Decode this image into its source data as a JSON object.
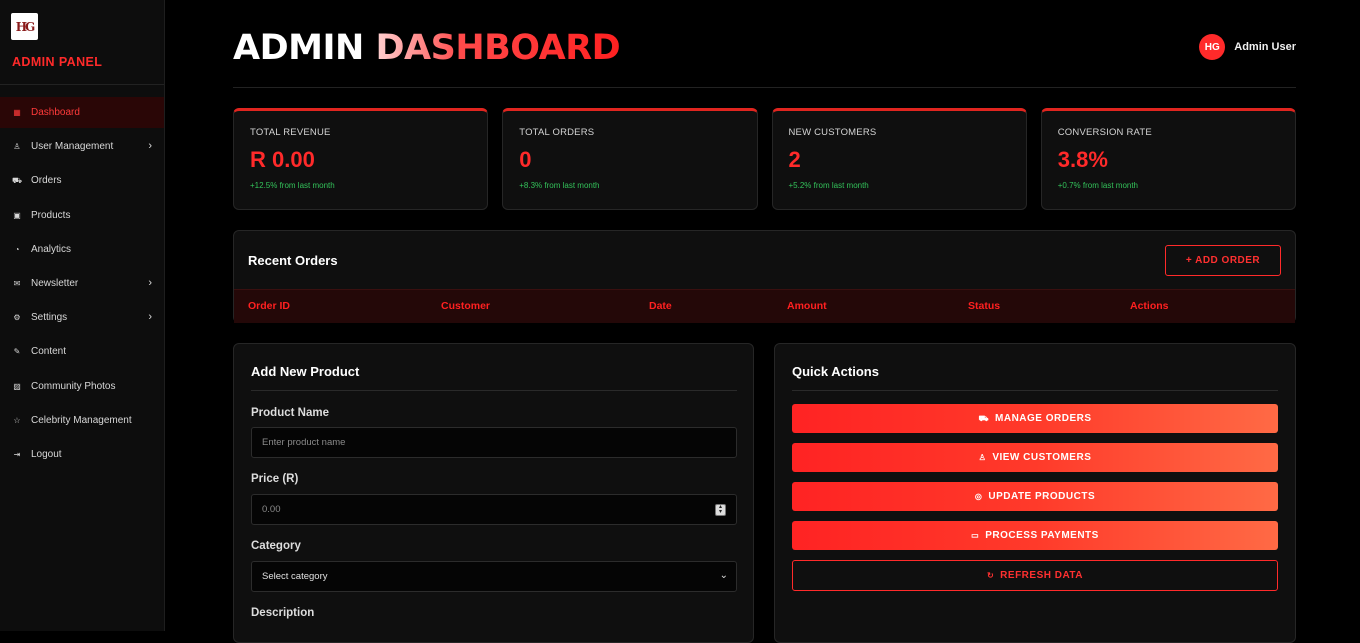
{
  "sidebar": {
    "logo_text": "HG",
    "brand": "ADMIN PANEL",
    "items": [
      {
        "label": "Dashboard",
        "icon": "grid-icon",
        "glyph": "▦",
        "active": true,
        "chevron": false
      },
      {
        "label": "User Management",
        "icon": "user-icon",
        "glyph": "♙",
        "active": false,
        "chevron": true
      },
      {
        "label": "Orders",
        "icon": "cart-icon",
        "glyph": "⛟",
        "active": false,
        "chevron": false
      },
      {
        "label": "Products",
        "icon": "box-icon",
        "glyph": "▣",
        "active": false,
        "chevron": false
      },
      {
        "label": "Analytics",
        "icon": "pie-chart-icon",
        "glyph": "◔",
        "active": false,
        "chevron": false
      },
      {
        "label": "Newsletter",
        "icon": "mail-icon",
        "glyph": "✉",
        "active": false,
        "chevron": true
      },
      {
        "label": "Settings",
        "icon": "gear-icon",
        "glyph": "⚙",
        "active": false,
        "chevron": true
      },
      {
        "label": "Content",
        "icon": "edit-icon",
        "glyph": "✎",
        "active": false,
        "chevron": false
      },
      {
        "label": "Community Photos",
        "icon": "image-icon",
        "glyph": "▨",
        "active": false,
        "chevron": false
      },
      {
        "label": "Celebrity Management",
        "icon": "star-icon",
        "glyph": "☆",
        "active": false,
        "chevron": false
      },
      {
        "label": "Logout",
        "icon": "logout-icon",
        "glyph": "⇥",
        "active": false,
        "chevron": false
      }
    ]
  },
  "header": {
    "title_part1": "ADMIN",
    "title_part2": "DASHBOARD",
    "user_initials": "HG",
    "user_name": "Admin User"
  },
  "stats": [
    {
      "label": "TOTAL REVENUE",
      "value": "R 0.00",
      "change": "+12.5% from last month"
    },
    {
      "label": "TOTAL ORDERS",
      "value": "0",
      "change": "+8.3% from last month"
    },
    {
      "label": "NEW CUSTOMERS",
      "value": "2",
      "change": "+5.2% from last month"
    },
    {
      "label": "CONVERSION RATE",
      "value": "3.8%",
      "change": "+0.7% from last month"
    }
  ],
  "orders": {
    "title": "Recent Orders",
    "add_button": "+ ADD ORDER",
    "columns": [
      "Order ID",
      "Customer",
      "Date",
      "Amount",
      "Status",
      "Actions"
    ]
  },
  "add_product": {
    "title": "Add New Product",
    "name_label": "Product Name",
    "name_placeholder": "Enter product name",
    "price_label": "Price (R)",
    "price_placeholder": "0.00",
    "category_label": "Category",
    "category_selected": "Select category",
    "description_label": "Description"
  },
  "quick_actions": {
    "title": "Quick Actions",
    "buttons": [
      {
        "label": "MANAGE ORDERS",
        "icon": "cart-icon",
        "glyph": "⛟"
      },
      {
        "label": "VIEW CUSTOMERS",
        "icon": "user-icon",
        "glyph": "♙"
      },
      {
        "label": "UPDATE PRODUCTS",
        "icon": "box-icon",
        "glyph": "◎"
      },
      {
        "label": "PROCESS PAYMENTS",
        "icon": "credit-card-icon",
        "glyph": "▭"
      }
    ],
    "refresh_label": "REFRESH DATA",
    "refresh_glyph": "↻"
  },
  "colors": {
    "accent": "#ff2a2a",
    "positive": "#33c25a",
    "background": "#000000",
    "panel": "#0f0f0f"
  }
}
